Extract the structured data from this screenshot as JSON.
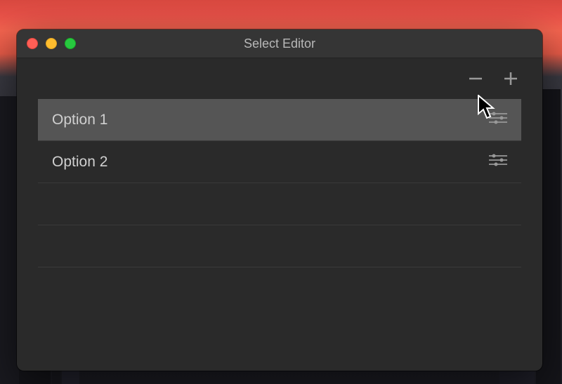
{
  "window": {
    "title": "Select Editor"
  },
  "toolbar": {
    "remove_tooltip": "Remove",
    "add_tooltip": "Add"
  },
  "list": {
    "items": [
      {
        "label": "Option 1",
        "selected": true
      },
      {
        "label": "Option 2",
        "selected": false
      }
    ],
    "empty_rows": 2
  },
  "colors": {
    "window_bg": "#2a2a2a",
    "titlebar_bg": "#353535",
    "selected_row": "#555555",
    "text": "#d0d0d0"
  }
}
